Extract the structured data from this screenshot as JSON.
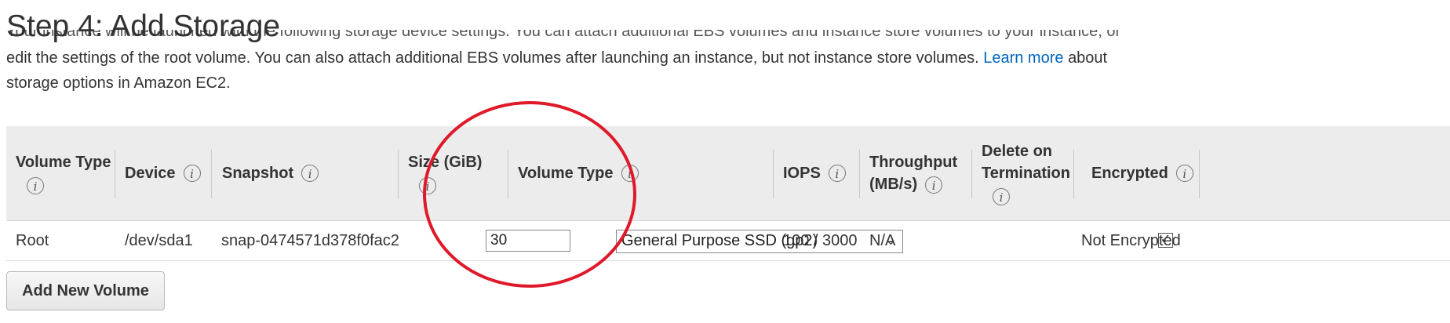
{
  "page": {
    "title": "Step 4: Add Storage",
    "desc_line1": "Your instance will be launched with the following storage device settings. You can attach additional EBS volumes and instance store volumes to your instance, or",
    "desc_line2_pre": "edit the settings of the root volume. You can also attach additional EBS volumes after launching an instance, but not instance store volumes.",
    "learn_more": "Learn more",
    "desc_line2_post": "about",
    "desc_line3": "storage options in Amazon EC2."
  },
  "table": {
    "headers": {
      "volume_type": "Volume Type",
      "device": "Device",
      "snapshot": "Snapshot",
      "size": "Size (GiB)",
      "ebs_volume_type": "Volume Type",
      "iops": "IOPS",
      "throughput_1": "Throughput",
      "throughput_2": "(MB/s)",
      "delete_1": "Delete on",
      "delete_2": "Termination",
      "encrypted": "Encrypted"
    },
    "info_glyph": "i",
    "row": {
      "volume_type": "Root",
      "device": "/dev/sda1",
      "snapshot": "snap-0474571d378f0fac2",
      "size": "30",
      "ebs_volume_type": "General Purpose SSD (gp2)",
      "iops": "100 / 3000",
      "throughput": "N/A",
      "delete_on_termination": true,
      "checkmark": "✓",
      "encrypted": "Not Encrypted"
    }
  },
  "buttons": {
    "add_new_volume": "Add New Volume"
  },
  "annotation": {
    "color": "#e0192a"
  },
  "icons": {
    "chevron": "chevron-down-icon",
    "info": "info-icon",
    "check": "checkmark-icon"
  }
}
